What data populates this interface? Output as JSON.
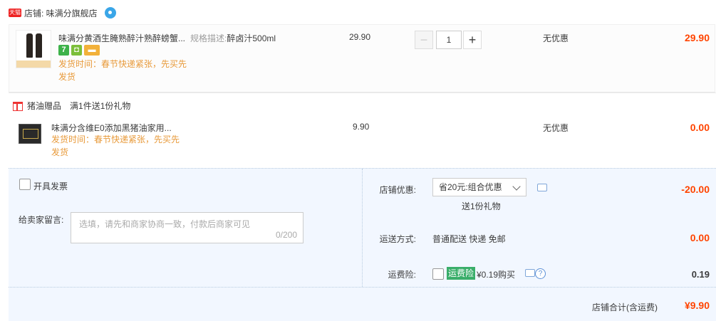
{
  "shop": {
    "badge": "天猫",
    "label": "店铺: 味满分旗舰店"
  },
  "items": [
    {
      "title": "味满分黄酒生腌熟醉汁熟醉螃蟹...",
      "sku_label": "规格描述:",
      "sku_value": "醉卤汁500ml",
      "price": "29.90",
      "quantity": "1",
      "discount": "无优惠",
      "subtotal": "29.90",
      "ship_note": "发货时间：春节快递紧张，先买先发货",
      "service_icons": [
        "seven-day-return-icon",
        "shield-icon",
        "card-icon"
      ]
    },
    {
      "title": "味满分含维E0添加黑猪油家用...",
      "price": "9.90",
      "discount": "无优惠",
      "subtotal": "0.00",
      "ship_note": "发货时间：春节快递紧张，先买先发货"
    }
  ],
  "gift": {
    "label": "猪油赠品",
    "desc": "满1件送1份礼物"
  },
  "invoice": {
    "label": "开具发票"
  },
  "message": {
    "label": "给卖家留言:",
    "placeholder": "选填，请先和商家协商一致，付款后商家可见",
    "count": "0/200"
  },
  "coupon": {
    "label": "店铺优惠:",
    "selected": "省20元:组合优惠",
    "gift_sub": "送1份礼物",
    "amount": "-20.00"
  },
  "shipping": {
    "label": "运送方式:",
    "method": "普通配送 快递 免邮",
    "amount": "0.00"
  },
  "insurance": {
    "label": "运费险:",
    "tag": "运费险",
    "price": "¥0.19购买",
    "amount": "0.19"
  },
  "total": {
    "label": "店铺合计(含运费)",
    "amount": "¥9.90"
  },
  "colors": {
    "price_red": "#ff4400",
    "ship_orange": "#e89a3a",
    "panel_bg": "#f2f7ff",
    "insurance_green": "#3aae6a"
  }
}
